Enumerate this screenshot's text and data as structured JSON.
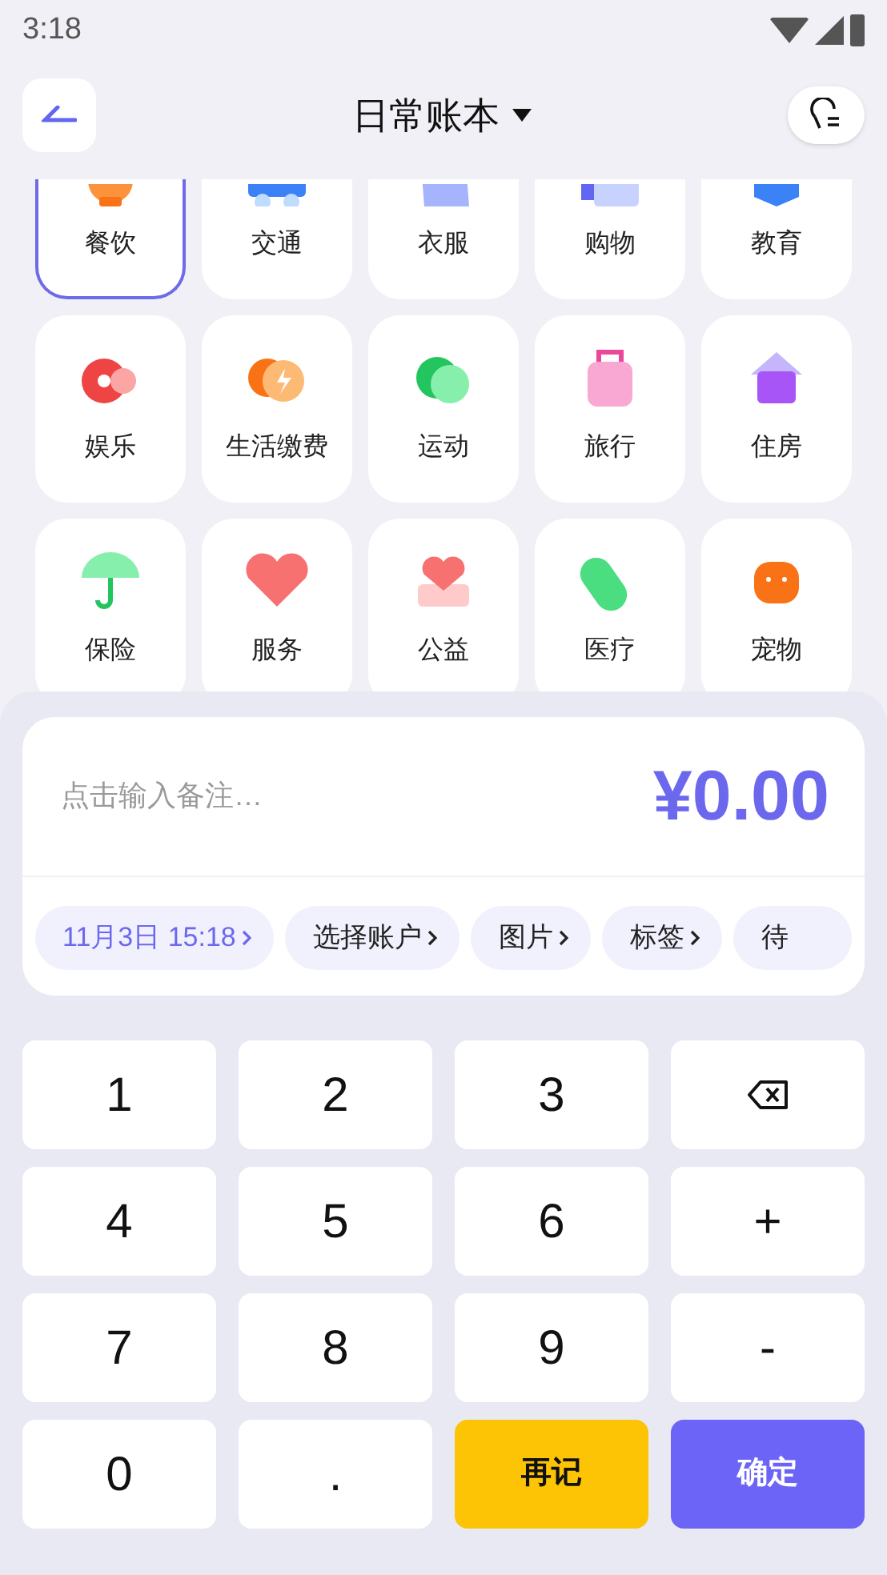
{
  "status_bar": {
    "time": "3:18"
  },
  "header": {
    "title": "日常账本"
  },
  "categories": [
    {
      "label": "餐饮",
      "selected": true
    },
    {
      "label": "交通",
      "selected": false
    },
    {
      "label": "衣服",
      "selected": false
    },
    {
      "label": "购物",
      "selected": false
    },
    {
      "label": "教育",
      "selected": false
    },
    {
      "label": "娱乐",
      "selected": false
    },
    {
      "label": "生活缴费",
      "selected": false
    },
    {
      "label": "运动",
      "selected": false
    },
    {
      "label": "旅行",
      "selected": false
    },
    {
      "label": "住房",
      "selected": false
    },
    {
      "label": "保险",
      "selected": false
    },
    {
      "label": "服务",
      "selected": false
    },
    {
      "label": "公益",
      "selected": false
    },
    {
      "label": "医疗",
      "selected": false
    },
    {
      "label": "宠物",
      "selected": false
    }
  ],
  "entry": {
    "placeholder": "点击输入备注…",
    "amount": "¥0.00",
    "chips": [
      {
        "label": "11月3日 15:18",
        "selected": true
      },
      {
        "label": "选择账户",
        "selected": false
      },
      {
        "label": "图片",
        "selected": false
      },
      {
        "label": "标签",
        "selected": false
      },
      {
        "label": "待",
        "selected": false
      }
    ]
  },
  "keypad": [
    {
      "kind": "digit",
      "label": "1"
    },
    {
      "kind": "digit",
      "label": "2"
    },
    {
      "kind": "digit",
      "label": "3"
    },
    {
      "kind": "backspace"
    },
    {
      "kind": "digit",
      "label": "4"
    },
    {
      "kind": "digit",
      "label": "5"
    },
    {
      "kind": "digit",
      "label": "6"
    },
    {
      "kind": "digit",
      "label": "+"
    },
    {
      "kind": "digit",
      "label": "7"
    },
    {
      "kind": "digit",
      "label": "8"
    },
    {
      "kind": "digit",
      "label": "9"
    },
    {
      "kind": "digit",
      "label": "-"
    },
    {
      "kind": "digit",
      "label": "0"
    },
    {
      "kind": "digit",
      "label": "."
    },
    {
      "kind": "again",
      "label": "再记"
    },
    {
      "kind": "confirm",
      "label": "确定"
    }
  ]
}
